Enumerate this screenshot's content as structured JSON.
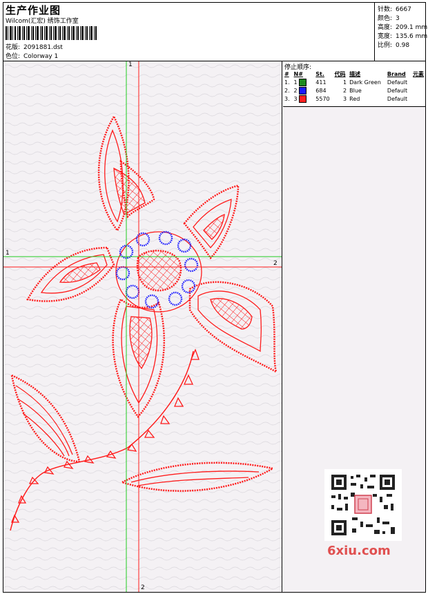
{
  "header": {
    "title": "生产作业图",
    "subtitle": "Wilcom(汇宏) 绣饰工作室",
    "design_label": "花版:",
    "design_value": "2091881.dst",
    "colorway_label": "色位:",
    "colorway_value": "Colorway 1"
  },
  "stats": [
    {
      "label": "针数:",
      "value": "6667"
    },
    {
      "label": "颜色:",
      "value": "3"
    },
    {
      "label": "高度:",
      "value": "209.1 mm"
    },
    {
      "label": "宽度:",
      "value": "135.6 mm"
    },
    {
      "label": "比例:",
      "value": "0.98"
    }
  ],
  "stop_sequence": {
    "title": "停止顺序:",
    "columns": [
      "#",
      "N#",
      "St.",
      "代码",
      "描述",
      "Brand",
      "元素"
    ],
    "rows": [
      {
        "idx": "1.",
        "n": "1",
        "color": "#1f8a1f",
        "st": "411",
        "code": "1",
        "desc": "Dark Green",
        "brand": "Default"
      },
      {
        "idx": "2.",
        "n": "2",
        "color": "#1a1aff",
        "st": "684",
        "code": "2",
        "desc": "Blue",
        "brand": "Default"
      },
      {
        "idx": "3.",
        "n": "3",
        "color": "#ff2020",
        "st": "5570",
        "code": "3",
        "desc": "Red",
        "brand": "Default"
      }
    ]
  },
  "axes": {
    "green_top": "1",
    "green_left": "1",
    "red_right": "2",
    "red_bottom": "2"
  },
  "colors": {
    "red": "#ff1a1a",
    "blue": "#1a1aff",
    "green": "#1fcc1f"
  },
  "watermark": {
    "text": "6xiu.com",
    "icon": "qr-code-icon"
  }
}
